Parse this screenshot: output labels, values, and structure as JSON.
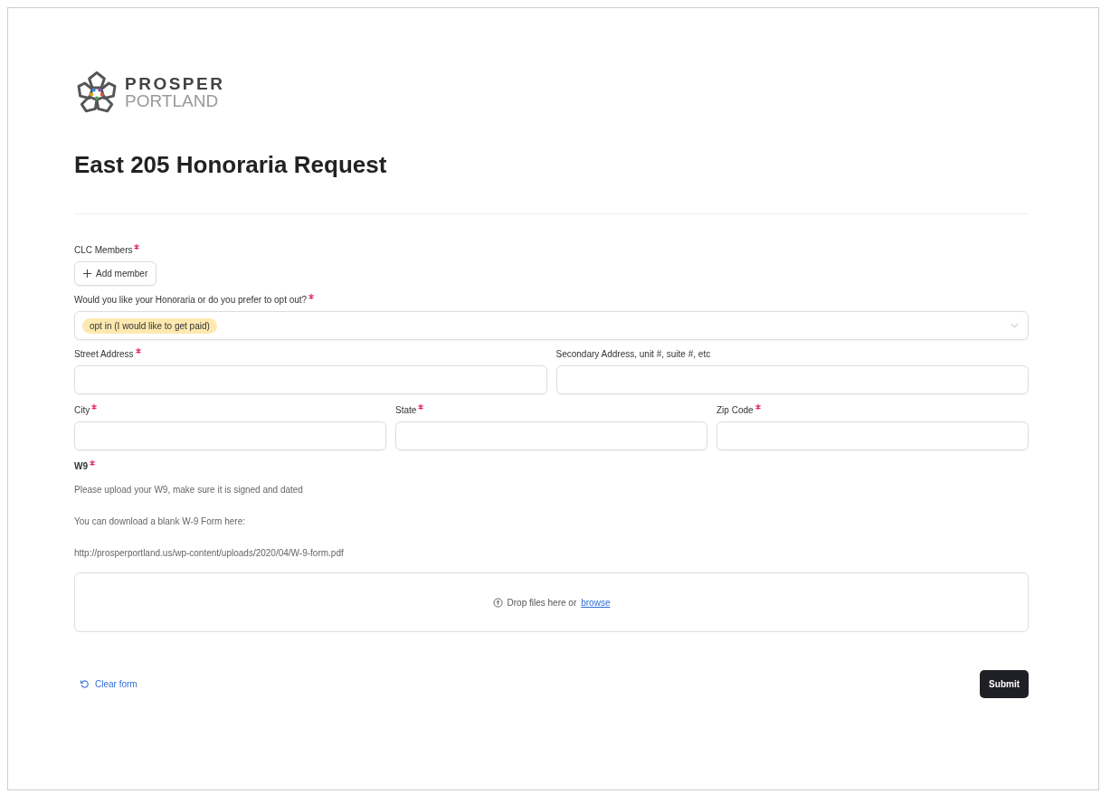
{
  "logo": {
    "line_1": "PROSPER",
    "line_2": "PORTLAND"
  },
  "title": "East 205 Honoraria Request",
  "fields": [
    {
      "kind": "members",
      "label": "CLC Members",
      "required": true,
      "button": "Add member"
    },
    {
      "kind": "select",
      "label": "Would you like your Honoraria or do you prefer to opt out?",
      "required": true,
      "value": "opt in (I would like to get paid)"
    },
    {
      "kind": "row",
      "fields": [
        {
          "label": "Street Address",
          "required": true
        },
        {
          "label": "Secondary Address, unit #, suite #, etc",
          "required": false
        }
      ]
    },
    {
      "kind": "row",
      "fields": [
        {
          "label": "City",
          "required": true
        },
        {
          "label": "State",
          "required": true
        },
        {
          "label": "Zip Code",
          "required": true
        }
      ]
    },
    {
      "kind": "file",
      "label": "W9",
      "required": true,
      "description": [
        "Please upload your W9, make sure it is signed and dated",
        "You can download a blank W-9 Form here:",
        "http://prosperportland.us/wp-content/uploads/2020/04/W-9-form.pdf"
      ],
      "drop_text": "Drop files here or",
      "browse_link": "browse"
    }
  ],
  "clear_link": "Clear form",
  "submit_button": "Submit"
}
